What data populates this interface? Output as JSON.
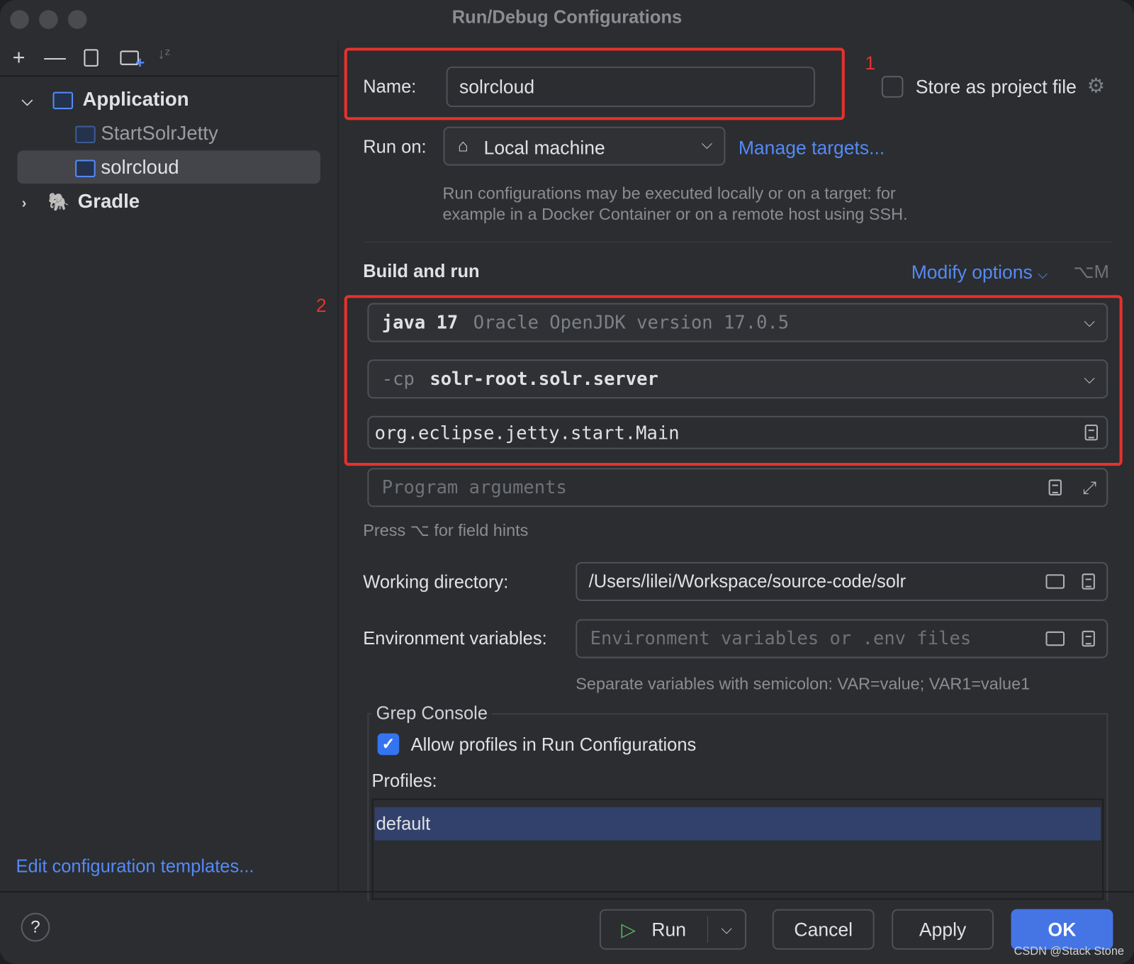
{
  "window": {
    "title": "Run/Debug Configurations"
  },
  "toolbar": {
    "icons": [
      "add-icon",
      "remove-icon",
      "copy-icon",
      "new-folder-icon",
      "sort-alpha-icon"
    ]
  },
  "tree": {
    "groups": [
      {
        "label": "Application",
        "expanded": true,
        "items": [
          {
            "label": "StartSolrJetty",
            "selected": false
          },
          {
            "label": "solrcloud",
            "selected": true
          }
        ]
      },
      {
        "label": "Gradle",
        "expanded": false,
        "items": []
      }
    ],
    "edit_templates_link": "Edit configuration templates..."
  },
  "form": {
    "name_label": "Name:",
    "name_value": "solrcloud",
    "annotation_1": "1",
    "annotation_2": "2",
    "store_as_project_file": {
      "label": "Store as project file",
      "checked": false
    },
    "run_on_label": "Run on:",
    "run_on_value": "Local machine",
    "manage_targets": "Manage targets...",
    "run_on_hint_1": "Run configurations may be executed locally or on a target: for",
    "run_on_hint_2": "example in a Docker Container or on a remote host using SSH.",
    "build_and_run": "Build and run",
    "modify_options": "Modify options",
    "modify_options_shortcut": "⌥M",
    "jdk_main": "java 17",
    "jdk_detail": "Oracle OpenJDK version 17.0.5",
    "cp_flag": "-cp",
    "cp_value": "solr-root.solr.server",
    "main_class": "org.eclipse.jetty.start.Main",
    "program_args_placeholder": "Program arguments",
    "field_hints": "Press ⌥ for field hints",
    "working_dir_label": "Working directory:",
    "working_dir_value": "/Users/lilei/Workspace/source-code/solr",
    "env_label": "Environment variables:",
    "env_placeholder": "Environment variables or .env files",
    "env_hint": "Separate variables with semicolon: VAR=value; VAR1=value1"
  },
  "grep_console": {
    "title": "Grep Console",
    "allow_profiles": {
      "label": "Allow profiles in Run Configurations",
      "checked": true
    },
    "profiles_label": "Profiles:",
    "profiles": [
      {
        "label": "default",
        "selected": true
      }
    ]
  },
  "footer": {
    "help": "?",
    "run": "Run",
    "cancel": "Cancel",
    "apply": "Apply",
    "ok": "OK",
    "watermark": "CSDN @Stack Stone"
  },
  "colors": {
    "accent": "#548af7",
    "ok_button": "#4575e5",
    "annotation_red": "#e5322d",
    "selection": "#43454a",
    "profile_selection": "#32416b"
  }
}
